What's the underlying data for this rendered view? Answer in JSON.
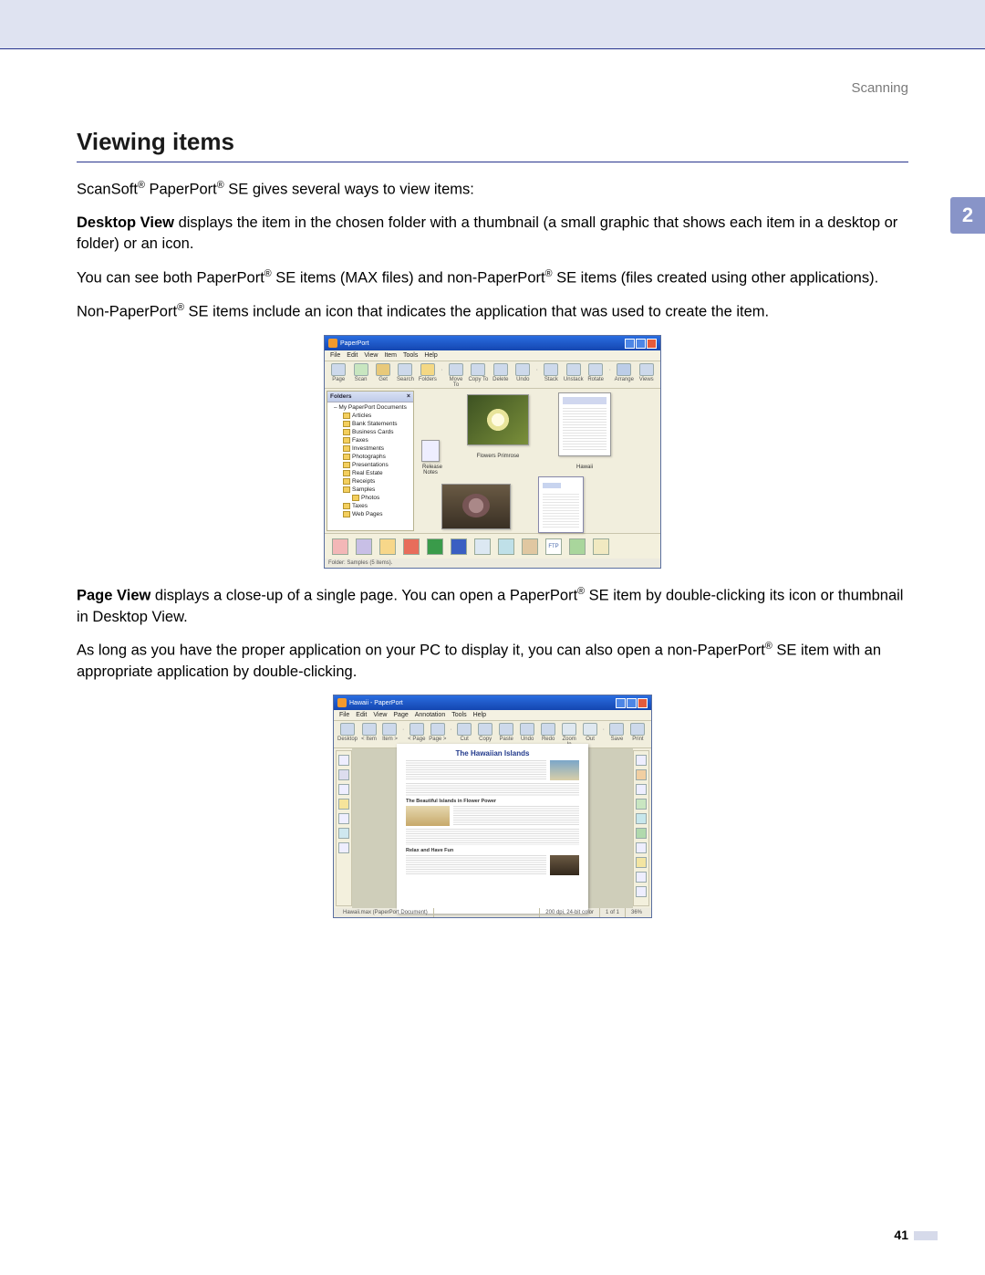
{
  "header": {
    "section": "Scanning"
  },
  "chapter_tab": "2",
  "page_number": "41",
  "section_title": "Viewing items",
  "paragraphs": {
    "intro": "ScanSoft® PaperPort® SE gives several ways to view items:",
    "desktop_view_bold": "Desktop View",
    "desktop_view_rest": " displays the item in the chosen folder with a thumbnail (a small graphic that shows each item in a desktop or folder) or an icon.",
    "p2": "You can see both PaperPort® SE items (MAX files) and non-PaperPort® SE items (files created using other applications).",
    "p3": "Non-PaperPort® SE items include an icon that indicates the application that was used to create the item.",
    "page_view_bold": "Page View",
    "page_view_rest": " displays a close-up of a single page. You can open a PaperPort® SE item by double-clicking its icon or thumbnail in Desktop View.",
    "p5": "As long as you have the proper application on your PC to display it, you can also open a non-PaperPort® SE item with an appropriate application by double-clicking."
  },
  "shot1": {
    "title": "PaperPort",
    "menus": [
      "File",
      "Edit",
      "View",
      "Item",
      "Tools",
      "Help"
    ],
    "toolbar": [
      "Page",
      "Scan",
      "Get",
      "Search",
      "Folders",
      "",
      "Move To",
      "Copy To",
      "Delete",
      "Undo",
      "",
      "Stack",
      "Unstack",
      "Rotate",
      "",
      "Arrange",
      "Views"
    ],
    "sidebar_header": "Folders",
    "tree": [
      {
        "lv": 1,
        "label": "My PaperPort Documents"
      },
      {
        "lv": 2,
        "label": "Articles"
      },
      {
        "lv": 2,
        "label": "Bank Statements"
      },
      {
        "lv": 2,
        "label": "Business Cards"
      },
      {
        "lv": 2,
        "label": "Faxes"
      },
      {
        "lv": 2,
        "label": "Investments"
      },
      {
        "lv": 2,
        "label": "Photographs"
      },
      {
        "lv": 2,
        "label": "Presentations"
      },
      {
        "lv": 2,
        "label": "Real Estate"
      },
      {
        "lv": 2,
        "label": "Receipts"
      },
      {
        "lv": 2,
        "label": "Samples"
      },
      {
        "lv": 3,
        "label": "Photos"
      },
      {
        "lv": 2,
        "label": "Taxes"
      },
      {
        "lv": 2,
        "label": "Web Pages"
      }
    ],
    "thumbs": {
      "notes": "Release Notes",
      "flower": "Flowers Primrose",
      "doc1": "Hawaii",
      "cat": "",
      "doc2": ""
    },
    "doc1_heading": "The Hawaiian Islands",
    "status": "Folder: Samples (5 items)."
  },
  "shot2": {
    "title": "Hawaii - PaperPort",
    "menus": [
      "File",
      "Edit",
      "View",
      "Page",
      "Annotation",
      "Tools",
      "Help"
    ],
    "toolbar": [
      "Desktop",
      "< Item",
      "Item >",
      "",
      "< Page",
      "Page >",
      "",
      "Cut",
      "Copy",
      "Paste",
      "Undo",
      "Redo",
      "Zoom In",
      "Out",
      "",
      "Save",
      "Print"
    ],
    "doc_title": "The Hawaiian Islands",
    "sub1": "The Beautiful Islands in Flower Power",
    "sub2": "Relax and Have Fun",
    "status": {
      "file": "Hawaii.max (PaperPort Document)",
      "res": "200 dpi, 24-bit color",
      "pg": "1 of 1",
      "zoom": "36%"
    }
  }
}
